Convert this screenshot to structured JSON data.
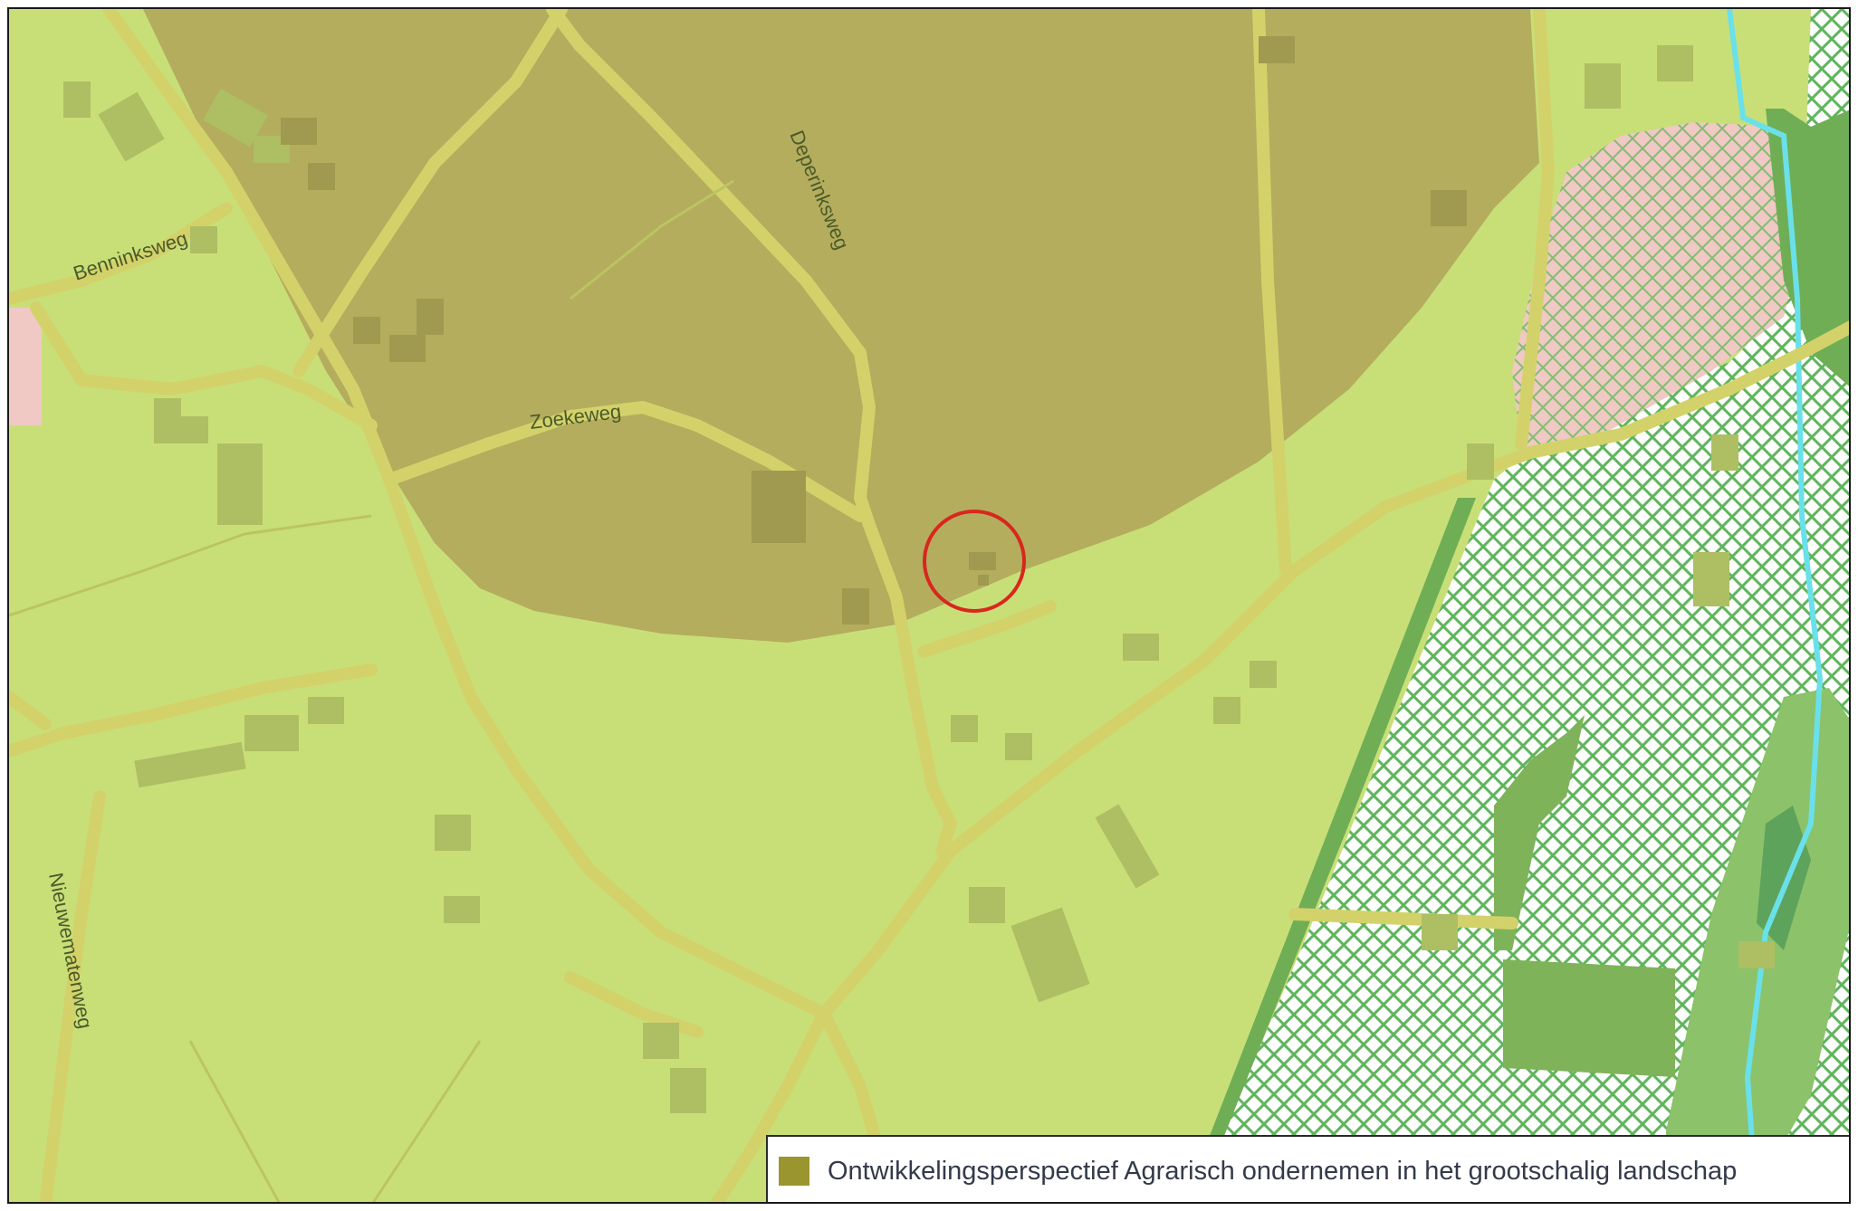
{
  "map": {
    "roads": [
      {
        "name": "Benninksweg"
      },
      {
        "name": "Deperinksweg"
      },
      {
        "name": "Zoekeweg"
      },
      {
        "name": "Nieuwematenweg"
      }
    ],
    "marker": {
      "type": "circle",
      "color": "#d9271e"
    }
  },
  "legend": {
    "items": [
      {
        "label": "Ontwikkelingsperspectief Agrarisch ondernemen in het grootschalig landschap",
        "color": "#9b9530"
      }
    ]
  },
  "colors": {
    "base_land": "#c8df78",
    "agrarian_overlay": "#b3aa5c",
    "road": "#d3d26a",
    "building": "#aebe63",
    "nature_hatch": "#5fb55c",
    "residential_pink": "#f0c8c4",
    "stream": "#6ae0ea",
    "forest_green": "#7fb35a"
  }
}
